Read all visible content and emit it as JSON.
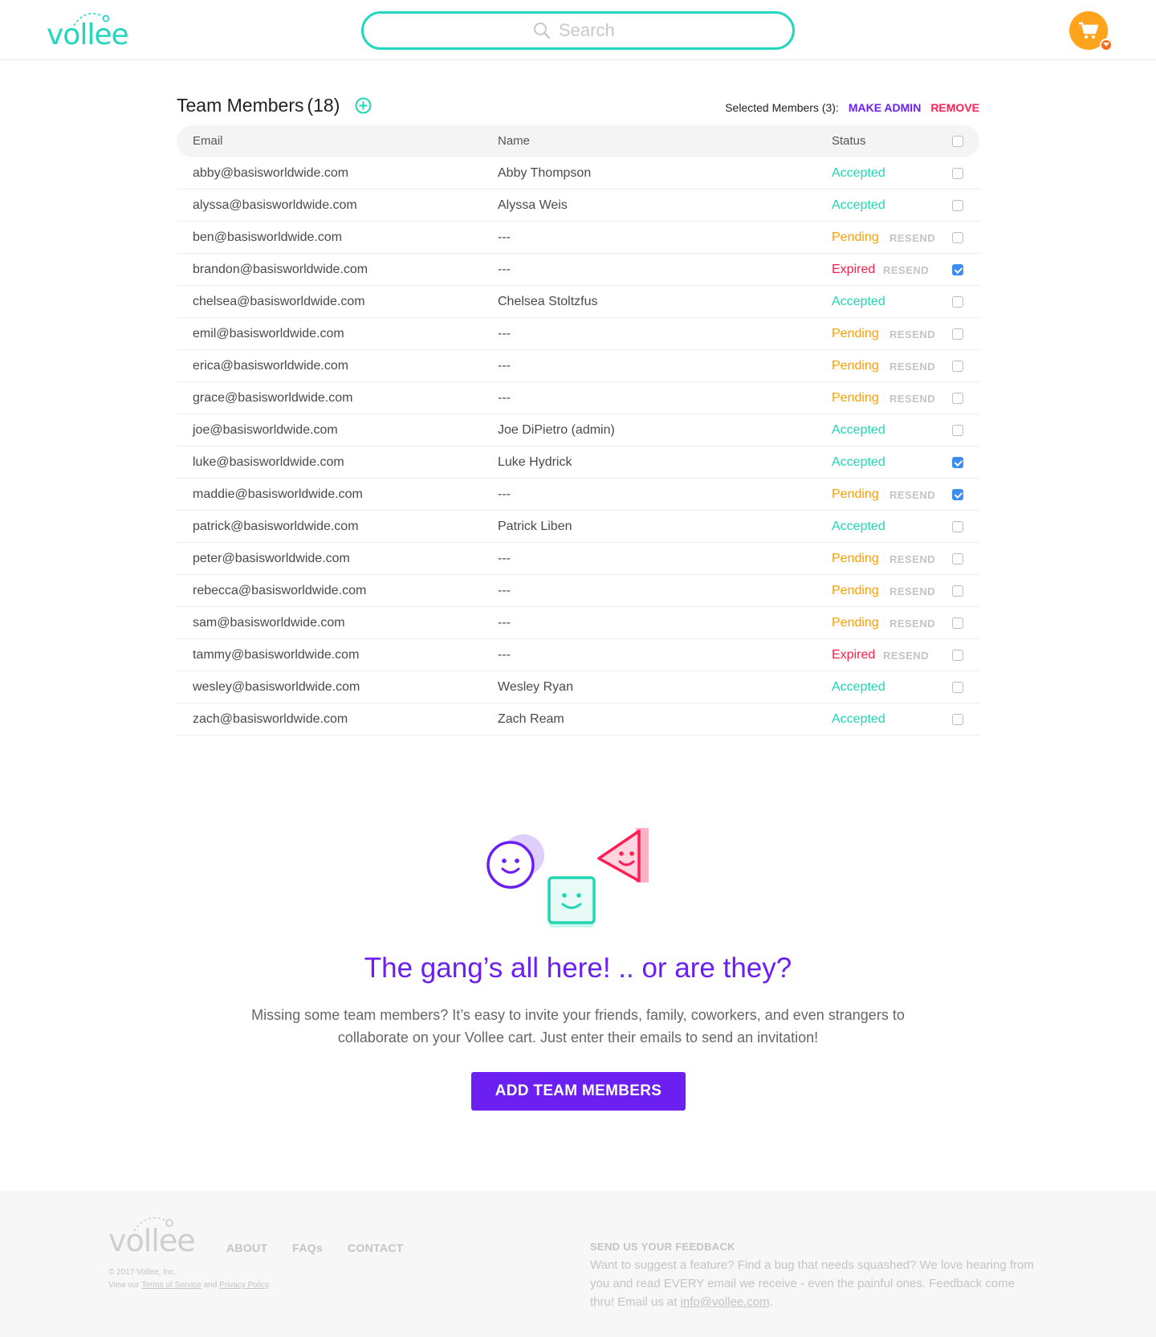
{
  "header": {
    "logo": "vollee",
    "search_placeholder": "Search"
  },
  "team": {
    "title": "Team Members",
    "count": "(18)",
    "selected_label": "Selected Members (3):",
    "make_admin": "MAKE ADMIN",
    "remove": "REMOVE",
    "columns": {
      "email": "Email",
      "name": "Name",
      "status": "Status"
    },
    "resend_label": "RESEND",
    "rows": [
      {
        "email": "abby@basisworldwide.com",
        "name": "Abby Thompson",
        "status": "Accepted",
        "checked": false
      },
      {
        "email": "alyssa@basisworldwide.com",
        "name": "Alyssa Weis",
        "status": "Accepted",
        "checked": false
      },
      {
        "email": "ben@basisworldwide.com",
        "name": "---",
        "status": "Pending",
        "checked": false
      },
      {
        "email": "brandon@basisworldwide.com",
        "name": "---",
        "status": "Expired",
        "checked": true
      },
      {
        "email": "chelsea@basisworldwide.com",
        "name": "Chelsea Stoltzfus",
        "status": "Accepted",
        "checked": false
      },
      {
        "email": "emil@basisworldwide.com",
        "name": "---",
        "status": "Pending",
        "checked": false
      },
      {
        "email": "erica@basisworldwide.com",
        "name": "---",
        "status": "Pending",
        "checked": false
      },
      {
        "email": "grace@basisworldwide.com",
        "name": "---",
        "status": "Pending",
        "checked": false
      },
      {
        "email": "joe@basisworldwide.com",
        "name": "Joe DiPietro (admin)",
        "status": "Accepted",
        "checked": false
      },
      {
        "email": "luke@basisworldwide.com",
        "name": "Luke Hydrick",
        "status": "Accepted",
        "checked": true
      },
      {
        "email": "maddie@basisworldwide.com",
        "name": "---",
        "status": "Pending",
        "checked": true
      },
      {
        "email": "patrick@basisworldwide.com",
        "name": "Patrick Liben",
        "status": "Accepted",
        "checked": false
      },
      {
        "email": "peter@basisworldwide.com",
        "name": "---",
        "status": "Pending",
        "checked": false
      },
      {
        "email": "rebecca@basisworldwide.com",
        "name": "---",
        "status": "Pending",
        "checked": false
      },
      {
        "email": "sam@basisworldwide.com",
        "name": "---",
        "status": "Pending",
        "checked": false
      },
      {
        "email": "tammy@basisworldwide.com",
        "name": "---",
        "status": "Expired",
        "checked": false
      },
      {
        "email": "wesley@basisworldwide.com",
        "name": "Wesley Ryan",
        "status": "Accepted",
        "checked": false
      },
      {
        "email": "zach@basisworldwide.com",
        "name": "Zach Ream",
        "status": "Accepted",
        "checked": false
      }
    ]
  },
  "cta": {
    "title": "The gang’s all here! .. or are they?",
    "text": "Missing some team members? It’s easy to invite your friends, family, coworkers, and even strangers to collaborate on your Vollee cart. Just enter their emails to send an invitation!",
    "button": "ADD TEAM MEMBERS"
  },
  "footer": {
    "logo": "vollee",
    "copyright": "© 2017 Vollee, Inc.",
    "view_our": "View our",
    "terms": "Terms of Service",
    "and": "and",
    "privacy": "Privacy Policy",
    "period": ".",
    "nav": [
      "ABOUT",
      "FAQs",
      "CONTACT"
    ],
    "feedback_title": "SEND US YOUR FEEDBACK",
    "feedback_text": "Want to suggest a feature? Find a bug that needs squashed? We love hearing from you and read EVERY email we receive - even the painful ones. Feedback come thru! Email us at",
    "feedback_email": "info@vollee.com",
    "feedback_end": "."
  },
  "colors": {
    "brand_teal": "#22d6c0",
    "brand_purple": "#6b1ff0",
    "accepted": "#22d6b4",
    "pending": "#ff9d00",
    "expired": "#ff1e45",
    "cart": "#ffa41c"
  },
  "icons": [
    "search-icon",
    "cart-icon",
    "add-circle-icon",
    "checkbox-icon"
  ]
}
